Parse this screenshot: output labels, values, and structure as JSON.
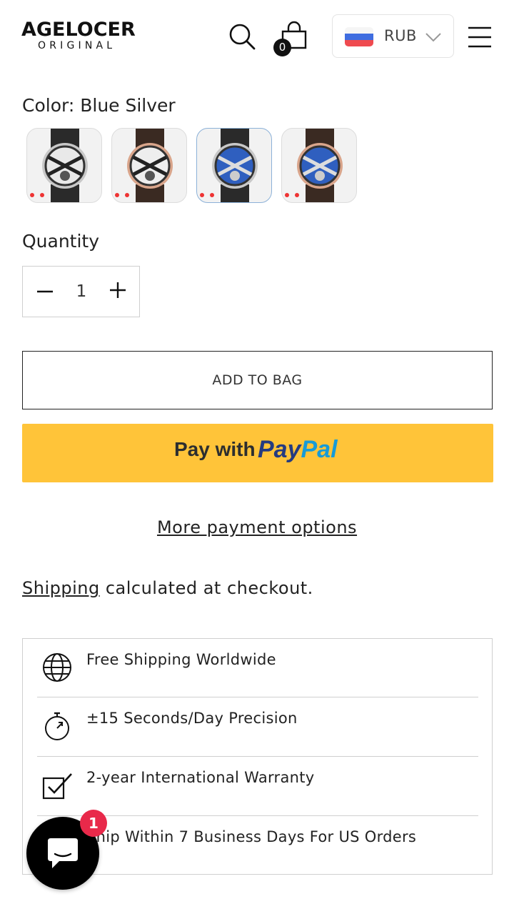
{
  "header": {
    "logo_line1": "AGELOCER",
    "logo_line2": "ORIGINAL",
    "cart_count": "0",
    "currency": {
      "code": "RUB",
      "flag": "russia-flag",
      "flag_colors": [
        "#f5f5f5",
        "#3f6de0",
        "#ef4a4f"
      ]
    },
    "icons": [
      "search-icon",
      "shopping-bag-icon",
      "chevron-down-icon",
      "hamburger-menu-icon"
    ]
  },
  "product": {
    "color_label": "Color:",
    "color_value": "Blue Silver",
    "swatches": [
      {
        "name": "Black Silver",
        "selected": false
      },
      {
        "name": "Black Rose Gold",
        "selected": false
      },
      {
        "name": "Blue Silver",
        "selected": true
      },
      {
        "name": "Blue Rose Gold",
        "selected": false
      }
    ],
    "quantity_label": "Quantity",
    "quantity_value": "1"
  },
  "actions": {
    "add_to_bag": "ADD TO BAG",
    "paypal_prefix": "Pay with",
    "paypal_brand_1": "Pay",
    "paypal_brand_2": "Pal",
    "more_payment": "More payment options"
  },
  "shipping": {
    "link": "Shipping",
    "rest": " calculated at checkout."
  },
  "features": [
    {
      "icon": "globe-icon",
      "text": "Free Shipping Worldwide"
    },
    {
      "icon": "stopwatch-icon",
      "text": "±15 Seconds/Day Precision"
    },
    {
      "icon": "checkbox-icon",
      "text": "2-year International Warranty"
    },
    {
      "icon": "truck-icon",
      "text": "Ship Within 7 Business Days For US Orders"
    }
  ],
  "chat": {
    "badge": "1",
    "icon": "chat-icon"
  },
  "colors": {
    "paypal_yellow": "#ffc439",
    "paypal_dark_blue": "#253b80",
    "paypal_light_blue": "#179bd7",
    "badge_red": "#e8294a"
  }
}
